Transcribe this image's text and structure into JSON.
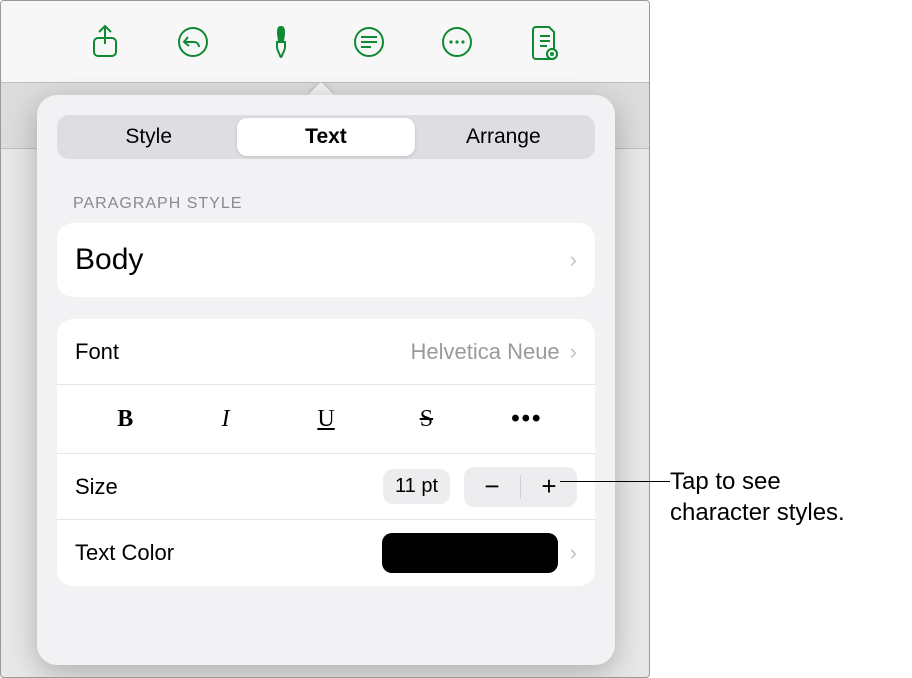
{
  "toolbar": {
    "icons": [
      "share-icon",
      "undo-icon",
      "format-icon",
      "insert-icon",
      "more-icon",
      "document-icon"
    ]
  },
  "popover": {
    "tabs": {
      "style": "Style",
      "text": "Text",
      "arrange": "Arrange"
    },
    "section_paragraph_label": "PARAGRAPH STYLE",
    "paragraph_style_value": "Body",
    "font": {
      "label": "Font",
      "value": "Helvetica Neue"
    },
    "format_buttons": {
      "bold": "B",
      "italic": "I",
      "underline": "U",
      "strike": "S",
      "more": "•••"
    },
    "size": {
      "label": "Size",
      "value": "11 pt",
      "minus": "−",
      "plus": "+"
    },
    "text_color": {
      "label": "Text Color",
      "swatch_hex": "#000000"
    }
  },
  "callout": {
    "text_line1": "Tap to see",
    "text_line2": "character styles."
  }
}
